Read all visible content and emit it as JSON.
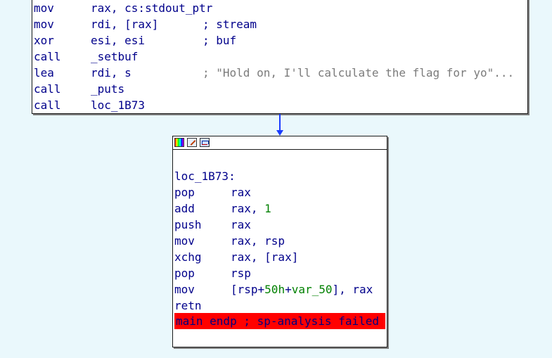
{
  "top_block": {
    "lines": [
      {
        "mnemonic": "mov",
        "operands": "rax, cs:stdout_ptr",
        "comment": ""
      },
      {
        "mnemonic": "mov",
        "operands": "rdi, [rax]",
        "comment": "; stream"
      },
      {
        "mnemonic": "xor",
        "operands": "esi, esi",
        "comment": "; buf"
      },
      {
        "mnemonic": "call",
        "operands": "_setbuf",
        "comment": ""
      },
      {
        "mnemonic": "lea",
        "operands": "rdi, s",
        "comment": "; \"Hold on, I'll calculate the flag for yo\"..."
      },
      {
        "mnemonic": "call",
        "operands": "_puts",
        "comment": ""
      },
      {
        "mnemonic": "call",
        "operands": "loc_1B73",
        "comment": ""
      }
    ]
  },
  "bottom_block": {
    "titlebar_icons": [
      "color-palette-icon",
      "rename-pencil-icon",
      "graph-view-icon"
    ],
    "label": "loc_1B73:",
    "lines": [
      {
        "mnemonic": "pop",
        "operands": "rax"
      },
      {
        "mnemonic": "add",
        "op_reg": "rax, ",
        "op_num": "1"
      },
      {
        "mnemonic": "push",
        "operands": "rax"
      },
      {
        "mnemonic": "mov",
        "operands": "rax, rsp"
      },
      {
        "mnemonic": "xchg",
        "operands": "rax, [rax]"
      },
      {
        "mnemonic": "pop",
        "operands": "rsp"
      },
      {
        "mnemonic": "mov",
        "op_a": "[rsp+",
        "op_num": "50h",
        "op_b": "+",
        "op_var": "var_50",
        "op_c": "], rax"
      },
      {
        "mnemonic": "retn",
        "operands": ""
      }
    ],
    "footer": {
      "func_name": "main",
      "text": " endp ; sp-analysis failed"
    }
  },
  "colors": {
    "background": "#eaf8fc",
    "instruction": "#00008b",
    "number": "#008000",
    "string_comment": "#7b7b7b",
    "edge": "#1a3cff",
    "error_highlight": "#ff0000"
  }
}
